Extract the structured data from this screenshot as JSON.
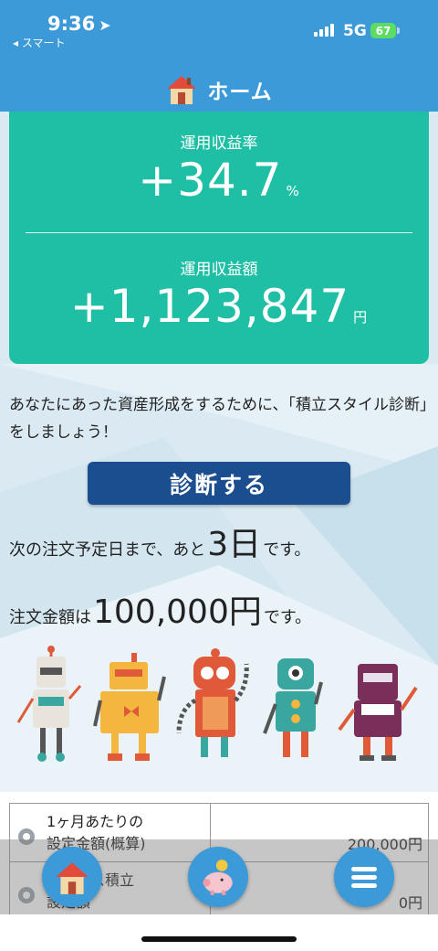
{
  "status_bar": {
    "time": "9:36",
    "back_app": "◂ スマート",
    "network": "5G",
    "battery": "67"
  },
  "header": {
    "title": "ホーム",
    "icon": "house-icon"
  },
  "summary": {
    "rate_label": "運用収益率",
    "rate_value": "+34.7",
    "rate_unit": "%",
    "amount_label": "運用収益額",
    "amount_value": "+1,123,847",
    "amount_unit": "円"
  },
  "intro_text": "あなたにあった資産形成をするために、「積立スタイル診断」をしましょう！",
  "diagnose_button": "診断する",
  "next_order": {
    "prefix": "次の注文予定日まで、あと",
    "days": "3日",
    "suffix": "です。"
  },
  "order_amount": {
    "prefix": "注文金額は",
    "amount": "100,000円",
    "suffix": "です。"
  },
  "settings_table": [
    {
      "label_line1": "1ヶ月あたりの",
      "label_line2": "設定金額(概算)",
      "value": "200,000円"
    },
    {
      "label_line1": "ボーナス積立",
      "label_line2": "設定額",
      "value": "0円"
    }
  ],
  "bottom_nav": [
    {
      "name": "home",
      "icon": "house-icon"
    },
    {
      "name": "savings",
      "icon": "piggy-bank-icon"
    },
    {
      "name": "menu",
      "icon": "hamburger-menu-icon"
    }
  ],
  "colors": {
    "header_blue": "#3d9ad8",
    "card_green": "#1fbfa6",
    "button_navy": "#1b4e8e"
  }
}
